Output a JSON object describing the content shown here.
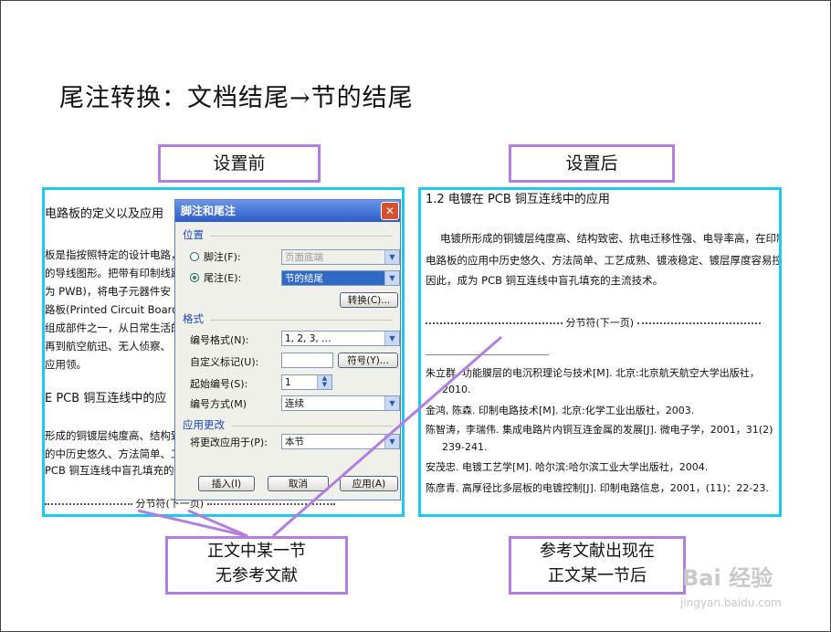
{
  "slide_title": "尾注转换：文档结尾→节的结尾",
  "labels": {
    "before": "设置前",
    "after": "设置后"
  },
  "left_doc": {
    "lines": [
      "电路板的定义以及应用",
      "板是指按照特定的设计电路，",
      "的导线图形。把带有印制线路",
      "为 PWB)，将电子元器件安",
      "路板(Printed Circuit Board，",
      "组成部件之一，从日常生活的",
      "再到航空航迅、无人侦察、",
      "应用领。"
    ],
    "heading2": "E PCB 铜互连线中的应",
    "lines2": [
      "形成的铜镀层纯度高、结构致",
      "的中历史悠久、方法简单、工",
      "PCB 铜互连线中盲孔填充的主"
    ],
    "section_break": "分节符(下一页)"
  },
  "dialog": {
    "title": "脚注和尾注",
    "position_label": "位置",
    "footnote_label": "脚注(F):",
    "footnote_value": "页面底端",
    "endnote_label": "尾注(E):",
    "endnote_value": "节的结尾",
    "convert_button": "转换(C)...",
    "format_label": "格式",
    "number_format_label": "编号格式(N):",
    "number_format_value": "1, 2, 3, …",
    "custom_mark_label": "自定义标记(U):",
    "symbol_button": "符号(Y)...",
    "start_at_label": "起始编号(S):",
    "start_at_value": "1",
    "numbering_label": "编号方式(M)",
    "numbering_value": "连续",
    "apply_changes_label": "应用更改",
    "apply_to_label": "将更改应用于(P):",
    "apply_to_value": "本节",
    "insert_button": "插入(I)",
    "cancel_button": "取消",
    "apply_button": "应用(A)"
  },
  "right_doc": {
    "heading": "1.2  电镀在 PCB 铜互连线中的应用",
    "para": [
      "电镀所形成的铜镀层纯度高、结构致密、抗电迁移性强、电导率高，在印制",
      "电路板的应用中历史悠久、方法简单、工艺成熟、镀液稳定、镀层厚度容易控制。",
      "因此，成为 PCB 铜互连线中盲孔填充的主流技术。"
    ],
    "section_break": "分节符(下一页)",
    "refs": [
      "朱立群. 功能膜层的电沉积理论与技术[M]. 北京:北京航天航空大学出版社，",
      "2010.",
      "金鸿, 陈森. 印制电路技术[M]. 北京:化学工业出版社，2003.",
      "陈智涛，李瑞伟. 集成电路片内铜互连金属的发展[J]. 微电子学，2001，31(2)",
      "239-241.",
      "安茂忠. 电镀工艺学[M]. 哈尔滨:哈尔滨工业大学出版社，2004.",
      "陈彦青. 高厚径比多层板的电镀控制[J]. 印制电路信息，2001，(11)：22-23."
    ]
  },
  "callouts": {
    "left": [
      "正文中某一节",
      "无参考文献"
    ],
    "right": [
      "参考文献出现在",
      "正文某一节后"
    ]
  },
  "watermark": {
    "brand": "Bai 经验",
    "url": "jingyan.baidu.com"
  },
  "colors": {
    "label_border": "#b27fe0",
    "panel_border": "#1ec8f0",
    "dialog_title": "#2b5bc7"
  }
}
